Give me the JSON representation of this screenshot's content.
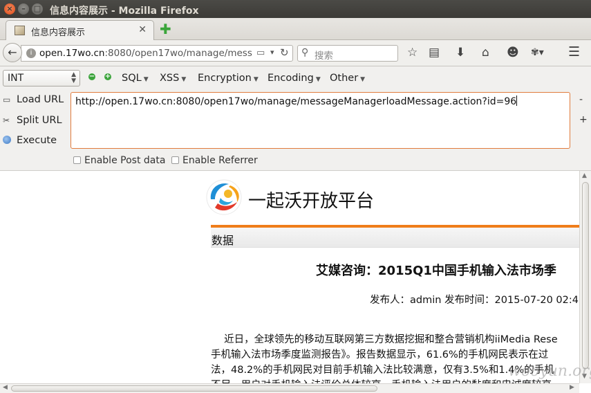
{
  "window": {
    "title": "信息内容展示 - Mozilla Firefox"
  },
  "tab": {
    "title": "信息内容展示"
  },
  "navbar": {
    "url_host": "open.17wo.cn",
    "url_rest": ":8080/open17wo/manage/mess",
    "search_placeholder": "搜索"
  },
  "hackbar": {
    "encoding_select": "INT",
    "menus": [
      "SQL",
      "XSS",
      "Encryption",
      "Encoding",
      "Other"
    ],
    "load_url": "Load URL",
    "split_url": "Split URL",
    "execute": "Execute",
    "url_value": "http://open.17wo.cn:8080/open17wo/manage/messageManagerloadMessage.action?id=96",
    "enable_post": "Enable Post data",
    "enable_referrer": "Enable Referrer"
  },
  "page": {
    "site_name": "一起沃开放平台",
    "section": "数据",
    "article_title": "艾媒咨询：2015Q1中国手机输入法市场季",
    "meta": "发布人：admin 发布时间：2015-07-20 02:4",
    "body_lines": [
      "　 近日，全球领先的移动互联网第三方数据挖掘和整合营销机构iiMedia Rese",
      "手机输入法市场季度监测报告》。报告数据显示，61.6%的手机网民表示在过",
      "法，48.2%的手机网民对目前手机输入法比较满意，仅有3.5%和1.4%的手机",
      "不足，用户对手机输入法评价总体较高。手机输入法用户的黏度和忠诚度较高"
    ],
    "watermark": "wooyun.org"
  },
  "colors": {
    "accent_orange": "#ef7d1a",
    "add_green": "#3ca43c"
  }
}
